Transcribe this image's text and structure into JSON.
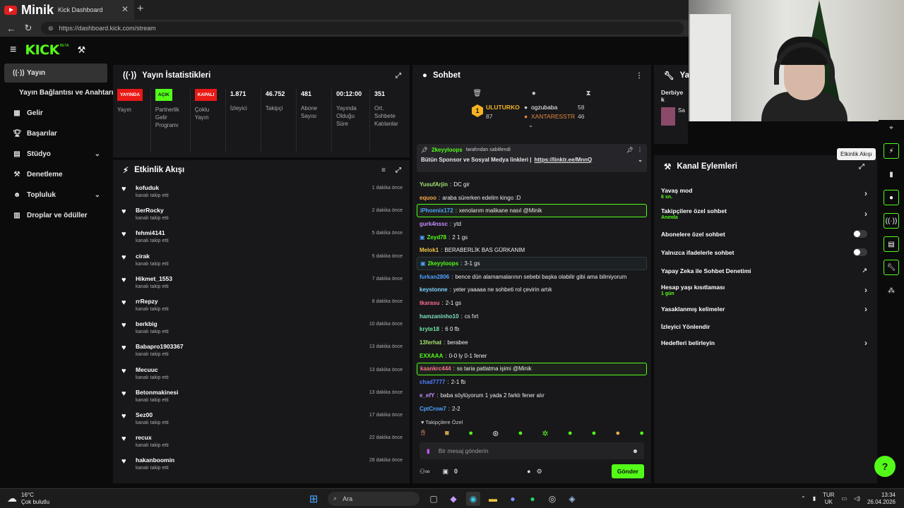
{
  "browser": {
    "channel": "Minik",
    "tab_title": "Kick Dashboard",
    "url": "https://dashboard.kick.com/stream"
  },
  "app": {
    "logo": "KICK",
    "beta": "BETA"
  },
  "sidebar": {
    "items": [
      {
        "label": "Yayın",
        "icon": "broadcast-icon"
      },
      {
        "label": "Yayın Bağlantısı ve Anahtarı",
        "icon": ""
      },
      {
        "label": "Gelir",
        "icon": "revenue-icon"
      },
      {
        "label": "Başarılar",
        "icon": "trophy-icon"
      },
      {
        "label": "Stüdyo",
        "icon": "studio-icon"
      },
      {
        "label": "Denetleme",
        "icon": "hammer-icon"
      },
      {
        "label": "Topluluk",
        "icon": "community-icon"
      },
      {
        "label": "Droplar ve ödüller",
        "icon": "gift-icon"
      }
    ]
  },
  "stats": {
    "title": "Yayın İstatistikleri",
    "items": [
      {
        "badge": "YAYINDA",
        "badge_color": "#e91916",
        "label": "Yayın"
      },
      {
        "badge": "AÇIK",
        "badge_color": "#53fc18",
        "label": "Partnerlik Gelir Programı"
      },
      {
        "badge": "KAPALI",
        "badge_color": "#e91916",
        "label": "Çoklu Yayın"
      },
      {
        "value": "1.871",
        "label": "İzleyici"
      },
      {
        "value": "46.752",
        "label": "Takipçi"
      },
      {
        "value": "481",
        "label": "Abone Sayısı"
      },
      {
        "value": "00:12:00",
        "label": "Yayında Olduğu Süre"
      },
      {
        "value": "351",
        "label": "Ort. Sohbete Katılanlar"
      }
    ]
  },
  "activity": {
    "title": "Etkinlik Akışı",
    "sub": "kanalı takip etti",
    "items": [
      {
        "name": "kofuduk",
        "time": "1 dakika önce"
      },
      {
        "name": "BerRocky",
        "time": "2 dakika önce"
      },
      {
        "name": "fehmi4141",
        "time": "5 dakika önce"
      },
      {
        "name": "cirak",
        "time": "5 dakika önce"
      },
      {
        "name": "Hikmet_1553",
        "time": "7 dakika önce"
      },
      {
        "name": "rrRepzy",
        "time": "8 dakika önce"
      },
      {
        "name": "berkbig",
        "time": "10 dakika önce"
      },
      {
        "name": "Babapro1903367",
        "time": "13 dakika önce"
      },
      {
        "name": "Mecuuc",
        "time": "13 dakika önce"
      },
      {
        "name": "Betonmakinesi",
        "time": "13 dakika önce"
      },
      {
        "name": "Sez00",
        "time": "17 dakika önce"
      },
      {
        "name": "recux",
        "time": "22 dakika önce"
      },
      {
        "name": "hakanboomin",
        "time": "28 dakika önce"
      }
    ]
  },
  "chat": {
    "title": "Sohbet",
    "leaders": {
      "first": {
        "name": "ULUTURKO",
        "count": "87",
        "rank": "1"
      },
      "second": {
        "name": "ogzubaba",
        "count": "58"
      },
      "third": {
        "name": "XANTARESSTR",
        "count": "46"
      }
    },
    "pinned": {
      "by_user": "2keyyloops",
      "by_text": "tarafından sabitlendi",
      "text": "Bütün Sponsor ve Sosyal Medya linkleri |",
      "link": "https://linktr.ee/MnnQ"
    },
    "messages": [
      {
        "user": "YusufArjin",
        "color": "#a3e36d",
        "text": "DC gir",
        "style": ""
      },
      {
        "user": "equoo",
        "color": "#f4a64a",
        "text": "araba sürerken edelim kingo :D",
        "style": ""
      },
      {
        "user": "iPhoenix172",
        "color": "#4fa3ff",
        "text": "xenolarım malikane nasıl @Minik",
        "style": "hl"
      },
      {
        "user": "gurk4nssc",
        "color": "#c58cff",
        "text": "ytd",
        "style": ""
      },
      {
        "user": "Zeyd78",
        "color": "#53fc18",
        "text": "2 1 gs",
        "style": ""
      },
      {
        "user": "Melok1",
        "color": "#f4c542",
        "text": "BERABERLİK BAS GÜRKANIM",
        "style": ""
      },
      {
        "user": "2keyyloops",
        "color": "#53fc18",
        "text": "3-1 gs",
        "style": "hl2"
      },
      {
        "user": "furkan2806",
        "color": "#4fa3ff",
        "text": "bence dün alamamalarının sebebi başka olabilir gibi ama bilmiyorum",
        "style": ""
      },
      {
        "user": "keystonne",
        "color": "#7fd4ff",
        "text": "yeter yaaaaa ne sohbeti rol çevirin artık",
        "style": ""
      },
      {
        "user": "tkarasu",
        "color": "#ff6f91",
        "text": "2-1 gs",
        "style": ""
      },
      {
        "user": "hamzaninho10",
        "color": "#7fe0c0",
        "text": "cs fırt",
        "style": ""
      },
      {
        "user": "kryte18",
        "color": "#6fe3a0",
        "text": "6 0 fb",
        "style": ""
      },
      {
        "user": "13ferhat",
        "color": "#a3e36d",
        "text": "berabee",
        "style": ""
      },
      {
        "user": "EXXAAA",
        "color": "#53fc18",
        "text": "0-0 ly 0-1 fener",
        "style": ""
      },
      {
        "user": "kaankrc444",
        "color": "#ff6f91",
        "text": "ss taria patlatma işimi @Minik",
        "style": "hl"
      },
      {
        "user": "chad7777",
        "color": "#4f7fff",
        "text": "2-1 fb",
        "style": ""
      },
      {
        "user": "e_efY",
        "color": "#c58cff",
        "text": "baba söylüyorum 1 yada 2 farklı fener alır",
        "style": ""
      },
      {
        "user": "CptCrow7",
        "color": "#4fa3ff",
        "text": "2-2",
        "style": ""
      }
    ],
    "followers_only": "Takipçilere Özel",
    "input_placeholder": "Bir mesaj gönderin",
    "count": "0",
    "send": "Gönder"
  },
  "top_panel": {
    "title": "Ya",
    "subtitle": "Derbiye k",
    "name": "Sa",
    "tag": "Tu"
  },
  "actions": {
    "title": "Kanal Eylemleri",
    "items": [
      {
        "label": "Yavaş mod",
        "sub": "6 sn.",
        "control": "chevron"
      },
      {
        "label": "Takipçilere özel sohbet",
        "sub": "Anında",
        "control": "chevron"
      },
      {
        "label": "Abonelere özel sohbet",
        "sub": "",
        "control": "toggle"
      },
      {
        "label": "Yalnızca ifadelerle sohbet",
        "sub": "",
        "control": "toggle"
      },
      {
        "label": "Yapay Zeka ile Sohbet Denetimi",
        "sub": "",
        "control": "external"
      },
      {
        "label": "Hesap yaşı kısıtlaması",
        "sub": "1 gün",
        "control": "chevron"
      },
      {
        "label": "Yasaklanmış kelimeler",
        "sub": "",
        "control": "chevron"
      },
      {
        "label": "İzleyici Yönlendir",
        "sub": "",
        "control": "none"
      },
      {
        "label": "Hedefleri belirleyin",
        "sub": "",
        "control": "chevron"
      }
    ]
  },
  "tooltip": "Etkinlik Akışı",
  "taskbar": {
    "weather_temp": "16°C",
    "weather_text": "Çok bulutlu",
    "search": "Ara",
    "lang": "TUR",
    "lang2": "UK",
    "time": "13:34",
    "date": "26.04.2026"
  },
  "colors": {
    "accent": "#53fc18",
    "panel": "#18181b",
    "bg": "#0b0b0c"
  }
}
